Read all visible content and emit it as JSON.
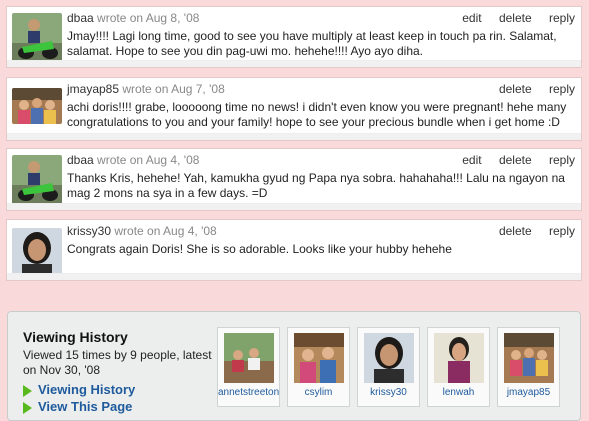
{
  "comments": [
    {
      "author": "dbaa",
      "wrote": "wrote on Aug 8, '08",
      "actions": [
        "edit",
        "delete",
        "reply"
      ],
      "text": "Jmay!!!! Lagi long time, good to see you have multiply at least keep in touch pa rin. Salamat, salamat. Hope to see you din pag-uwi mo. hehehe!!!! Ayo ayo diha."
    },
    {
      "author": "jmayap85",
      "wrote": "wrote on Aug 7, '08",
      "actions": [
        "delete",
        "reply"
      ],
      "text": "achi doris!!!! grabe, looooong time no news! i didn't even know you were pregnant! hehe many congratulations to you and your family! hope to see your precious bundle when i get home :D"
    },
    {
      "author": "dbaa",
      "wrote": "wrote on Aug 4, '08",
      "actions": [
        "edit",
        "delete",
        "reply"
      ],
      "text": "Thanks Kris, hehehe! Yah, kamukha gyud ng Papa nya sobra. hahahaha!!! Lalu na ngayon na mag 2 mons na sya in a few days. =D"
    },
    {
      "author": "krissy30",
      "wrote": "wrote on Aug 4, '08",
      "actions": [
        "delete",
        "reply"
      ],
      "text": "Congrats again Doris! She is so adorable. Looks like your hubby hehehe"
    }
  ],
  "history": {
    "title": "Viewing History",
    "meta": "Viewed 15 times by 9 people, latest on Nov 30, '08",
    "link1": "Viewing History",
    "link2": "View This Page",
    "viewers": [
      "annetstreeton",
      "csylim",
      "krissy30",
      "lenwah",
      "jmayap85"
    ]
  },
  "colors": {
    "background": "#f9d9d9",
    "link": "#1e5a9c",
    "arrow": "#58b91d"
  }
}
